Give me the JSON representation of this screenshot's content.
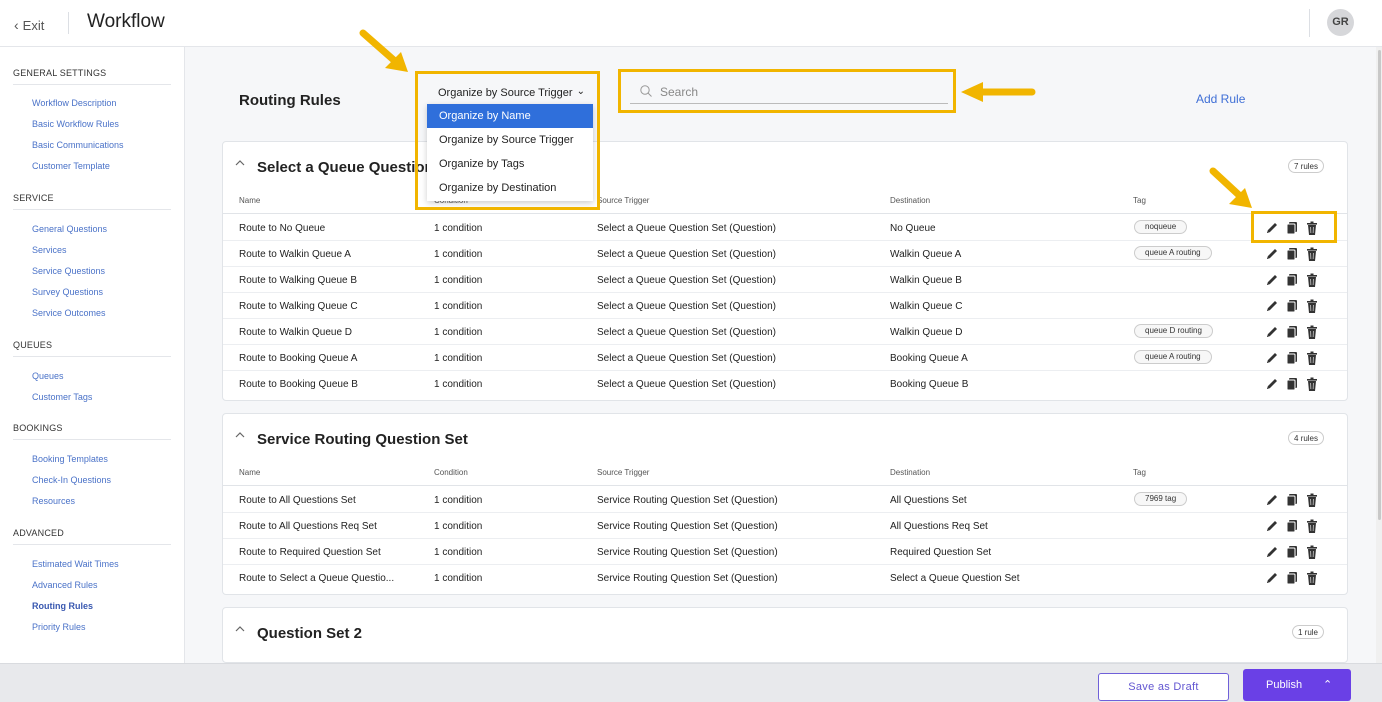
{
  "header": {
    "exit_label": "Exit",
    "title": "Workflow",
    "avatar_initials": "GR"
  },
  "sidebar": {
    "sections": [
      {
        "label": "GENERAL SETTINGS",
        "items": [
          "Workflow Description",
          "Basic Workflow Rules",
          "Basic Communications",
          "Customer Template"
        ]
      },
      {
        "label": "SERVICE",
        "items": [
          "General Questions",
          "Services",
          "Service Questions",
          "Survey Questions",
          "Service Outcomes"
        ]
      },
      {
        "label": "QUEUES",
        "items": [
          "Queues",
          "Customer Tags"
        ]
      },
      {
        "label": "BOOKINGS",
        "items": [
          "Booking Templates",
          "Check-In Questions",
          "Resources"
        ]
      },
      {
        "label": "ADVANCED",
        "items": [
          "Estimated Wait Times",
          "Advanced Rules",
          "Routing Rules",
          "Priority Rules"
        ]
      }
    ],
    "active_item": "Routing Rules"
  },
  "main": {
    "title": "Routing Rules",
    "organize": {
      "selected": "Organize by Source Trigger",
      "options": [
        "Organize by Name",
        "Organize by Source Trigger",
        "Organize by Tags",
        "Organize by Destination"
      ],
      "highlighted": "Organize by Name"
    },
    "search": {
      "placeholder": "Search",
      "value": ""
    },
    "add_rule_label": "Add Rule",
    "columns": [
      "Name",
      "Condition",
      "Source Trigger",
      "Destination",
      "Tag"
    ],
    "groups": [
      {
        "title": "Select a Queue Question Set",
        "count": "7 rules",
        "rows": [
          {
            "name": "Route to No Queue",
            "condition": "1 condition",
            "trigger": "Select a Queue Question Set (Question)",
            "destination": "No Queue",
            "tag": "noqueue"
          },
          {
            "name": "Route to Walkin Queue A",
            "condition": "1 condition",
            "trigger": "Select a Queue Question Set (Question)",
            "destination": "Walkin Queue A",
            "tag": "queue A routing"
          },
          {
            "name": "Route to Walking Queue B",
            "condition": "1 condition",
            "trigger": "Select a Queue Question Set (Question)",
            "destination": "Walkin Queue B",
            "tag": ""
          },
          {
            "name": "Route to Walking Queue C",
            "condition": "1 condition",
            "trigger": "Select a Queue Question Set (Question)",
            "destination": "Walkin Queue C",
            "tag": ""
          },
          {
            "name": "Route to Walkin Queue D",
            "condition": "1 condition",
            "trigger": "Select a Queue Question Set (Question)",
            "destination": "Walkin Queue D",
            "tag": "queue D routing"
          },
          {
            "name": "Route to Booking Queue A",
            "condition": "1 condition",
            "trigger": "Select a Queue Question Set (Question)",
            "destination": "Booking Queue A",
            "tag": "queue A routing"
          },
          {
            "name": "Route to Booking Queue B",
            "condition": "1 condition",
            "trigger": "Select a Queue Question Set (Question)",
            "destination": "Booking Queue B",
            "tag": ""
          }
        ]
      },
      {
        "title": "Service Routing Question Set",
        "count": "4 rules",
        "rows": [
          {
            "name": "Route to All Questions Set",
            "condition": "1 condition",
            "trigger": "Service Routing Question Set (Question)",
            "destination": "All Questions Set",
            "tag": "7969 tag"
          },
          {
            "name": "Route to All Questions Req Set",
            "condition": "1 condition",
            "trigger": "Service Routing Question Set (Question)",
            "destination": "All Questions Req Set",
            "tag": ""
          },
          {
            "name": "Route to Required Question Set",
            "condition": "1 condition",
            "trigger": "Service Routing Question Set (Question)",
            "destination": "Required Question Set",
            "tag": ""
          },
          {
            "name": "Route to Select a Queue Questio...",
            "condition": "1 condition",
            "trigger": "Service Routing Question Set (Question)",
            "destination": "Select a Queue Question Set",
            "tag": ""
          }
        ]
      },
      {
        "title": "Question Set 2",
        "count": "1 rule",
        "rows": []
      }
    ]
  },
  "footer": {
    "save_draft_label": "Save as Draft",
    "publish_label": "Publish"
  },
  "colors": {
    "accent": "#6a40e6",
    "link": "#4a72c8",
    "highlight": "#f1b500",
    "dropdown_selected": "#2f6fdb"
  }
}
